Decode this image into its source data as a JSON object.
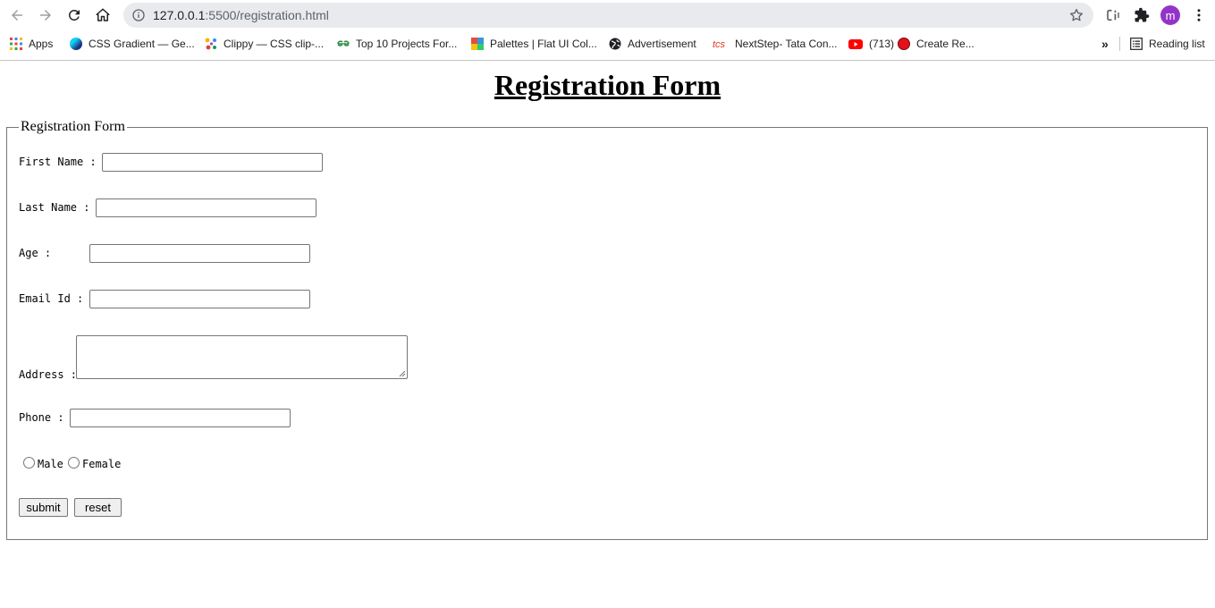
{
  "browser": {
    "url_host": "127.0.0.1",
    "url_rest": ":5500/registration.html",
    "profile_initial": "m"
  },
  "bookmarks": [
    {
      "label": "Apps",
      "icon": "apps-grid-icon"
    },
    {
      "label": "CSS Gradient — Ge...",
      "icon": "css-gradient-favicon"
    },
    {
      "label": "Clippy — CSS clip-...",
      "icon": "clippy-favicon"
    },
    {
      "label": "Top 10 Projects For...",
      "icon": "geeksforgeeks-favicon"
    },
    {
      "label": "Palettes | Flat UI Col...",
      "icon": "palettes-favicon"
    },
    {
      "label": "Advertisement",
      "icon": "globe-icon"
    },
    {
      "label": "NextStep- Tata Con...",
      "icon": "tcs-favicon"
    },
    {
      "label": "(713)",
      "icon": "youtube-favicon"
    },
    {
      "label": "Create Re...",
      "icon": "red-dot-favicon"
    }
  ],
  "reading_list": "Reading list",
  "more_bookmarks": "»",
  "page": {
    "title": "Registration Form",
    "legend": "Registration Form",
    "fields": {
      "first_name_label": "First Name : ",
      "last_name_label": "Last Name : ",
      "age_label": "Age :      ",
      "email_label": "Email Id : ",
      "address_label": "Address :",
      "phone_label": "Phone : "
    },
    "gender": {
      "male": "Male",
      "female": "Female"
    },
    "buttons": {
      "submit": "submit",
      "reset": "reset"
    }
  },
  "colors": {
    "avatar": "#9334c9",
    "youtube": "#ff0000",
    "tcs": "#e2341d"
  }
}
